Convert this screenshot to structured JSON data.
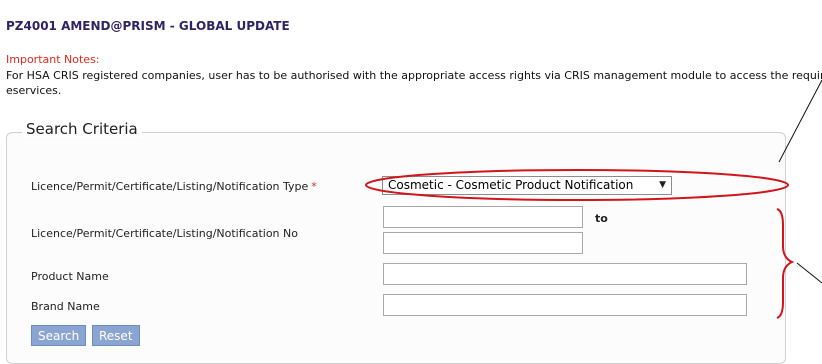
{
  "header": {
    "title": "PZ4001 AMEND@PRISM - GLOBAL UPDATE"
  },
  "notes": {
    "heading": "Important Notes:",
    "body": "For HSA CRIS registered companies, user has to be authorised with the appropriate access rights via CRIS management module to access the required eservices."
  },
  "search": {
    "legend": "Search Criteria",
    "type_label": "Licence/Permit/Certificate/Listing/Notification Type",
    "required_mark": "*",
    "type_selected": "Cosmetic - Cosmetic Product Notification",
    "no_label": "Licence/Permit/Certificate/Listing/Notification No",
    "to_label": "to",
    "product_label": "Product Name",
    "brand_label": "Brand Name",
    "search_button": "Search",
    "reset_button": "Reset"
  },
  "colors": {
    "title": "#2f2466",
    "notes_heading": "#e02b1e",
    "button": "#8aa5d1",
    "annotation": "#d0151b"
  },
  "icons": {
    "select_arrow": "chevron-down-icon"
  }
}
